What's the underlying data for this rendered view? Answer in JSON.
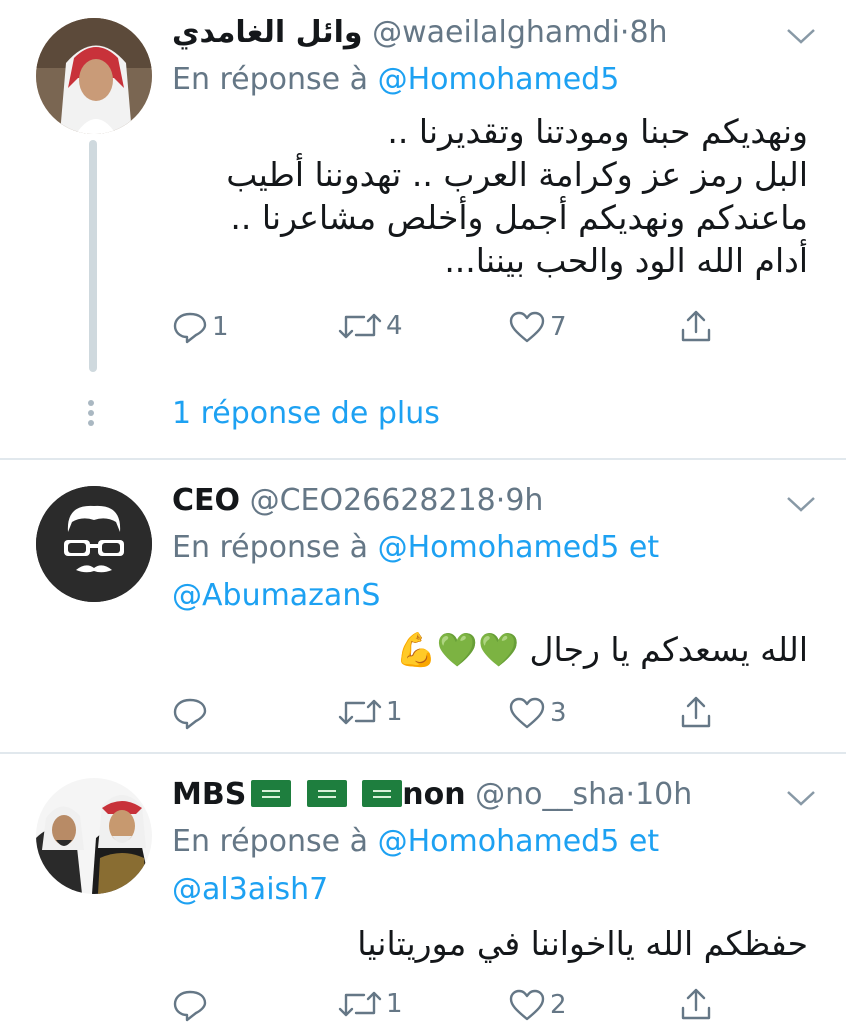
{
  "tweets": [
    {
      "name": "وائل الغامدي",
      "handle": "@waeilalghamdi",
      "time": "8h",
      "reply_prefix": "En réponse à",
      "reply_to": "@Homohamed5",
      "body_lines": [
        "ونهديكم حبنا ومودتنا وتقديرنا ..",
        "البل رمز عز وكرامة العرب .. تهدوننا أطيب",
        "ماعندكم ونهديكم أجمل وأخلص مشاعرنا ..",
        "أدام الله الود والحب بيننا..."
      ],
      "replies": "1",
      "retweets": "4",
      "likes": "7",
      "more_replies": "1 réponse de plus"
    },
    {
      "name": "CEO",
      "handle": "@CEO26628218",
      "time": "9h",
      "reply_prefix": "En réponse à",
      "reply_to": "@Homohamed5",
      "reply_and": "et",
      "reply_to_2": "@AbumazanS",
      "body": "الله يسعدكم يا رجال 💚💚💪",
      "replies": "",
      "retweets": "1",
      "likes": "3"
    },
    {
      "name_prefix": "MBS",
      "name_suffix": "non",
      "handle": "@no__sha",
      "time": "10h",
      "reply_prefix": "En réponse à",
      "reply_to": "@Homohamed5",
      "reply_and": "et",
      "reply_to_2": "@al3aish7",
      "body": "حفظكم الله يااخواننا في موريتانيا",
      "replies": "",
      "retweets": "1",
      "likes": "2"
    }
  ],
  "separator": "·",
  "icons": [
    "chevron-down-icon",
    "reply-icon",
    "retweet-icon",
    "like-icon",
    "share-icon",
    "saudi-flag-icon"
  ],
  "colors": {
    "link": "#1da1f2",
    "meta": "#657786",
    "text": "#14171a",
    "divider": "#e1e8ed"
  }
}
